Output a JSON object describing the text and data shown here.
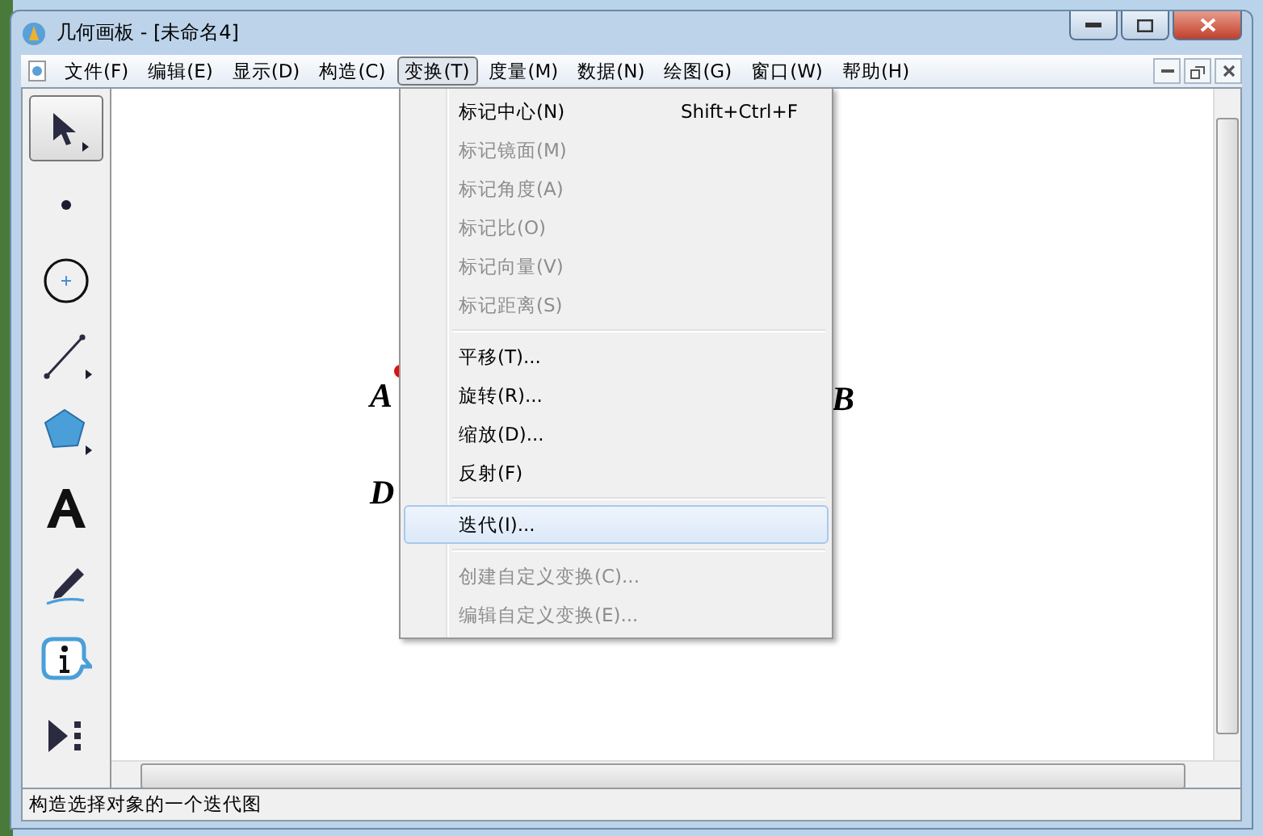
{
  "window": {
    "title": "几何画板 - [未命名4]"
  },
  "menubar": [
    {
      "label": "文件(F)",
      "selected": false
    },
    {
      "label": "编辑(E)",
      "selected": false
    },
    {
      "label": "显示(D)",
      "selected": false
    },
    {
      "label": "构造(C)",
      "selected": false
    },
    {
      "label": "变换(T)",
      "selected": true
    },
    {
      "label": "度量(M)",
      "selected": false
    },
    {
      "label": "数据(N)",
      "selected": false
    },
    {
      "label": "绘图(G)",
      "selected": false
    },
    {
      "label": "窗口(W)",
      "selected": false
    },
    {
      "label": "帮助(H)",
      "selected": false
    }
  ],
  "toolbox": [
    {
      "kind": "arrow",
      "selected": true
    },
    {
      "kind": "point",
      "selected": false
    },
    {
      "kind": "compass",
      "selected": false
    },
    {
      "kind": "line",
      "selected": false
    },
    {
      "kind": "polygon",
      "selected": false
    },
    {
      "kind": "text",
      "selected": false
    },
    {
      "kind": "marker",
      "selected": false
    },
    {
      "kind": "info",
      "selected": false
    },
    {
      "kind": "custom",
      "selected": false
    }
  ],
  "canvas": {
    "labels": [
      {
        "text": "A"
      },
      {
        "text": "B"
      },
      {
        "text": "D"
      }
    ]
  },
  "menu": [
    {
      "kind": "item",
      "label": "标记中心(N)",
      "shortcut": "Shift+Ctrl+F",
      "disabled": false,
      "selected": false
    },
    {
      "kind": "item",
      "label": "标记镜面(M)",
      "disabled": true,
      "selected": false
    },
    {
      "kind": "item",
      "label": "标记角度(A)",
      "disabled": true,
      "selected": false
    },
    {
      "kind": "item",
      "label": "标记比(O)",
      "disabled": true,
      "selected": false
    },
    {
      "kind": "item",
      "label": "标记向量(V)",
      "disabled": true,
      "selected": false
    },
    {
      "kind": "item",
      "label": "标记距离(S)",
      "disabled": true,
      "selected": false
    },
    {
      "kind": "separator"
    },
    {
      "kind": "item",
      "label": "平移(T)...",
      "disabled": false,
      "selected": false
    },
    {
      "kind": "item",
      "label": "旋转(R)...",
      "disabled": false,
      "selected": false
    },
    {
      "kind": "item",
      "label": "缩放(D)...",
      "disabled": false,
      "selected": false
    },
    {
      "kind": "item",
      "label": "反射(F)",
      "disabled": false,
      "selected": false
    },
    {
      "kind": "separator"
    },
    {
      "kind": "item",
      "label": "迭代(I)...",
      "disabled": false,
      "selected": true
    },
    {
      "kind": "separator"
    },
    {
      "kind": "item",
      "label": "创建自定义变换(C)...",
      "disabled": true,
      "selected": false
    },
    {
      "kind": "item",
      "label": "编辑自定义变换(E)...",
      "disabled": true,
      "selected": false
    }
  ],
  "status_bar": "构造选择对象的一个迭代图"
}
